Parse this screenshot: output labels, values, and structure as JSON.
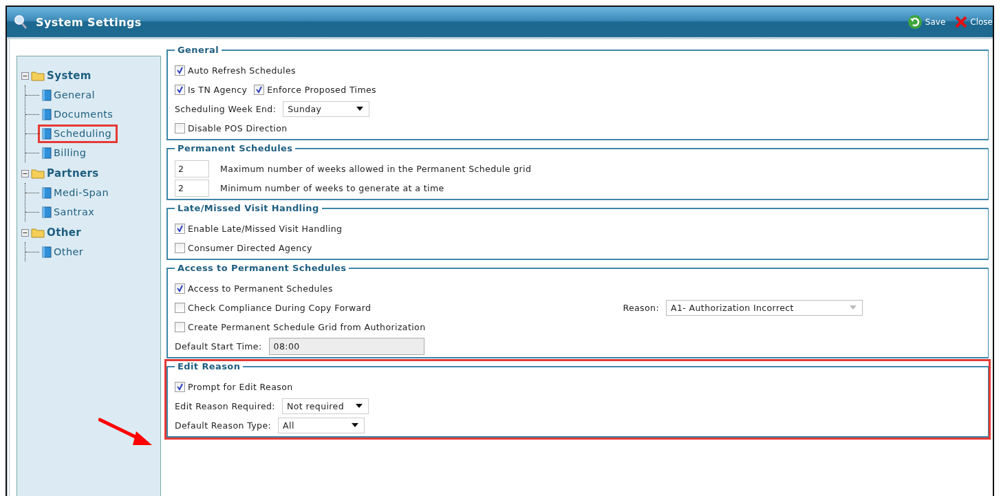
{
  "window": {
    "title": "System Settings"
  },
  "toolbar": [
    {
      "kind": "save",
      "label": "Save"
    },
    {
      "kind": "close",
      "label": "Close"
    }
  ],
  "tree": [
    {
      "label": "System",
      "expanded": true,
      "children": [
        {
          "label": "General",
          "highlighted": false
        },
        {
          "label": "Documents",
          "highlighted": false
        },
        {
          "label": "Scheduling",
          "highlighted": true
        },
        {
          "label": "Billing",
          "highlighted": false
        }
      ]
    },
    {
      "label": "Partners",
      "expanded": true,
      "children": [
        {
          "label": "Medi-Span",
          "highlighted": false
        },
        {
          "label": "Santrax",
          "highlighted": false
        }
      ]
    },
    {
      "label": "Other",
      "expanded": true,
      "children": [
        {
          "label": "Other",
          "highlighted": false
        }
      ]
    }
  ],
  "sections": [
    {
      "title": "General",
      "highlighted": false,
      "rows": [
        [
          {
            "kind": "checkbox",
            "label": "Auto Refresh Schedules",
            "checked": true
          }
        ],
        [
          {
            "kind": "checkbox",
            "label": "Is TN Agency",
            "checked": true
          },
          {
            "kind": "checkbox",
            "label": "Enforce Proposed Times",
            "checked": true
          }
        ],
        [
          {
            "kind": "select",
            "label": "Scheduling Week End:",
            "value": "Sunday",
            "disabled": false
          }
        ],
        [
          {
            "kind": "checkbox",
            "label": "Disable POS Direction",
            "checked": false
          }
        ]
      ]
    },
    {
      "title": "Permanent Schedules",
      "highlighted": false,
      "rows": [
        [
          {
            "kind": "number",
            "value": "2",
            "label": "Maximum number of weeks allowed in the Permanent Schedule grid"
          }
        ],
        [
          {
            "kind": "number",
            "value": "2",
            "label": "Minimum number of weeks to generate at a time"
          }
        ]
      ]
    },
    {
      "title": "Late/Missed Visit Handling",
      "highlighted": false,
      "rows": [
        [
          {
            "kind": "checkbox",
            "label": "Enable Late/Missed Visit Handling",
            "checked": true
          }
        ],
        [
          {
            "kind": "checkbox",
            "label": "Consumer Directed Agency",
            "checked": false
          }
        ]
      ]
    },
    {
      "title": "Access to Permanent Schedules",
      "highlighted": false,
      "rows": [
        [
          {
            "kind": "checkbox",
            "label": "Access to Permanent Schedules",
            "checked": true
          }
        ],
        [
          {
            "kind": "checkbox",
            "label": "Check Compliance During Copy Forward",
            "checked": false
          },
          {
            "kind": "select",
            "label": "Reason:",
            "value": "A1- Authorization Incorrect",
            "disabled": true
          }
        ],
        [
          {
            "kind": "checkbox",
            "label": "Create Permanent Schedule Grid from Authorization",
            "checked": false
          }
        ],
        [
          {
            "kind": "text",
            "label": "Default Start Time:",
            "value": "08:00",
            "disabled": true
          }
        ]
      ]
    },
    {
      "title": "Edit Reason",
      "highlighted": true,
      "rows": [
        [
          {
            "kind": "checkbox",
            "label": "Prompt for Edit Reason",
            "checked": true
          }
        ],
        [
          {
            "kind": "select",
            "label": "Edit Reason Required:",
            "value": "Not required",
            "disabled": false
          }
        ],
        [
          {
            "kind": "select",
            "label": "Default Reason Type:",
            "value": "All",
            "disabled": false
          }
        ]
      ]
    }
  ]
}
